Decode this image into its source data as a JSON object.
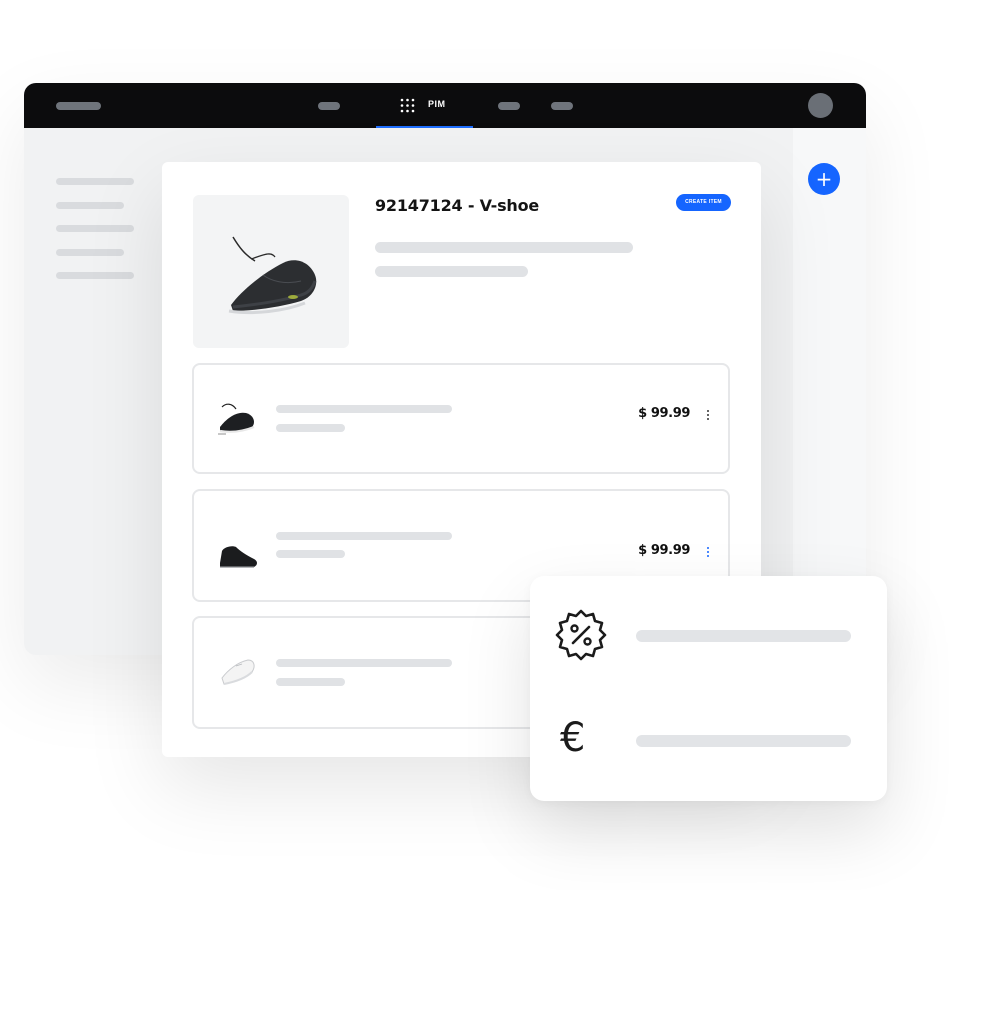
{
  "nav": {
    "active_tab_label": "PIM"
  },
  "product": {
    "title": "92147124 - V-shoe",
    "create_button_label": "CREATE ITEM"
  },
  "variants": [
    {
      "price": "$ 99.99"
    },
    {
      "price": "$ 99.99"
    },
    {
      "price": ""
    }
  ],
  "popup": {
    "currency_symbol": "€"
  },
  "icons": {
    "add": "plus-icon",
    "apps": "grid-icon",
    "discount": "discount-badge-icon",
    "more": "more-vertical-icon"
  },
  "colors": {
    "accent": "#1565ff",
    "topbar": "#0c0c0d"
  }
}
